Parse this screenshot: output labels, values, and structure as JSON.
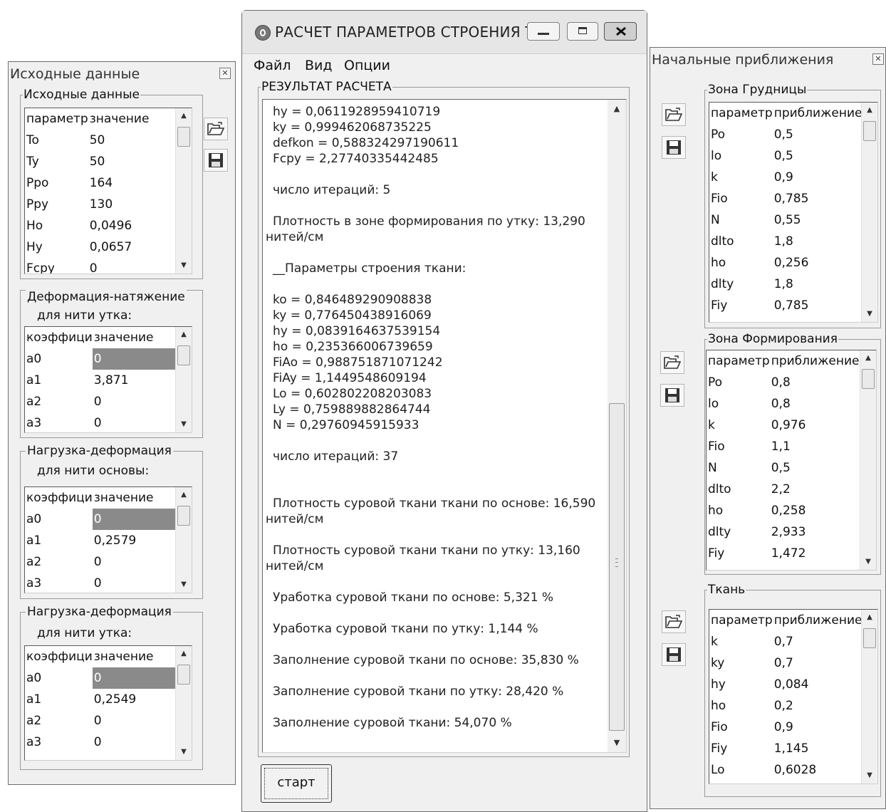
{
  "left_panel": {
    "title": "Исходные данные",
    "group1": {
      "legend": "Исходные данные",
      "headers": [
        "параметр",
        "значение"
      ],
      "rows": [
        [
          "To",
          "50"
        ],
        [
          "Ty",
          "50"
        ],
        [
          "Ppo",
          "164"
        ],
        [
          "Ppy",
          "130"
        ],
        [
          "Ho",
          "0,0496"
        ],
        [
          "Hy",
          "0,0657"
        ],
        [
          "Fcpy",
          "0"
        ]
      ]
    },
    "group2": {
      "legend_line1": "Деформация-натяжение",
      "legend_line2": "для нити утка:",
      "headers": [
        "коэффици",
        "значение"
      ],
      "rows": [
        [
          "a0",
          "0"
        ],
        [
          "a1",
          "3,871"
        ],
        [
          "a2",
          "0"
        ],
        [
          "a3",
          "0"
        ]
      ]
    },
    "group3": {
      "legend_line1": "Нагрузка-деформация",
      "legend_line2": "для нити основы:",
      "headers": [
        "коэффици",
        "значение"
      ],
      "rows": [
        [
          "a0",
          "0"
        ],
        [
          "a1",
          "0,2579"
        ],
        [
          "a2",
          "0"
        ],
        [
          "a3",
          "0"
        ]
      ]
    },
    "group4": {
      "legend_line1": "Нагрузка-деформация",
      "legend_line2": "для нити утка:",
      "headers": [
        "коэффици",
        "значение"
      ],
      "rows": [
        [
          "a0",
          "0"
        ],
        [
          "a1",
          "0,2549"
        ],
        [
          "a2",
          "0"
        ],
        [
          "a3",
          "0"
        ]
      ]
    }
  },
  "main_window": {
    "title": "РАСЧЕТ  ПАРАМЕТРОВ СТРОЕНИЯ ТК...",
    "menu": [
      "Файл",
      "Вид",
      "Опции"
    ],
    "result_legend": "РЕЗУЛЬТАТ РАСЧЕТА",
    "result_lines": [
      "hy = 0,0611928959410719",
      "ky = 0,999462068735225",
      "defkon = 0,588324297190611",
      "Fcpy = 2,27740335442485",
      "число итераций: 5",
      "Плотность в зоне формирования по утку: 13,290",
      "нитей/см",
      "__Параметры строения ткани:",
      "ko = 0,846489290908838",
      "ky = 0,776450438916069",
      "hy = 0,0839164637539154",
      "ho = 0,235366006739659",
      "FiAo = 0,988751871071242",
      "FiAy = 1,1449548609194",
      "Lo = 0,602802208203083",
      "Ly = 0,759889882864744",
      "N = 0,29760945915933",
      "число итераций: 37",
      "Плотность суровой ткани ткани по основе:  16,590",
      "нитей/см",
      "Плотность суровой ткани ткани по утку:  13,160",
      "нитей/см",
      "Уработка суровой ткани по основе:  5,321 %",
      "Уработка суровой ткани по утку:  1,144 %",
      "Заполнение суровой ткани по основе:  35,830 %",
      "Заполнение суровой ткани по утку:  28,420 %",
      "Заполнение суровой ткани:  54,070 %"
    ],
    "start_button": "старт"
  },
  "right_panel": {
    "title": "Начальные приближения",
    "group1": {
      "legend": "Зона Грудницы",
      "headers": [
        "параметр",
        "приближение"
      ],
      "rows": [
        [
          "Po",
          "0,5"
        ],
        [
          "lo",
          "0,5"
        ],
        [
          "k",
          "0,9"
        ],
        [
          "Fio",
          "0,785"
        ],
        [
          "N",
          "0,55"
        ],
        [
          "dlto",
          "1,8"
        ],
        [
          "ho",
          "0,256"
        ],
        [
          "dlty",
          "1,8"
        ],
        [
          "Fiy",
          "0,785"
        ]
      ]
    },
    "group2": {
      "legend": "Зона Формирования",
      "headers": [
        "параметр",
        "приближение"
      ],
      "rows": [
        [
          "Po",
          "0,8"
        ],
        [
          "lo",
          "0,8"
        ],
        [
          "k",
          "0,976"
        ],
        [
          "Fio",
          "1,1"
        ],
        [
          "N",
          "0,5"
        ],
        [
          "dlto",
          "2,2"
        ],
        [
          "ho",
          "0,258"
        ],
        [
          "dlty",
          "2,933"
        ],
        [
          "Fiy",
          "1,472"
        ]
      ]
    },
    "group3": {
      "legend": "Ткань",
      "headers": [
        "параметр",
        "приближение"
      ],
      "rows": [
        [
          "k",
          "0,7"
        ],
        [
          "ky",
          "0,7"
        ],
        [
          "hy",
          "0,084"
        ],
        [
          "ho",
          "0,2"
        ],
        [
          "Fio",
          "0,9"
        ],
        [
          "Fiy",
          "1,145"
        ],
        [
          "Lo",
          "0,6028"
        ]
      ]
    }
  },
  "icons": {
    "open": "open-folder-icon",
    "save": "floppy-save-icon",
    "close": "close-icon"
  }
}
